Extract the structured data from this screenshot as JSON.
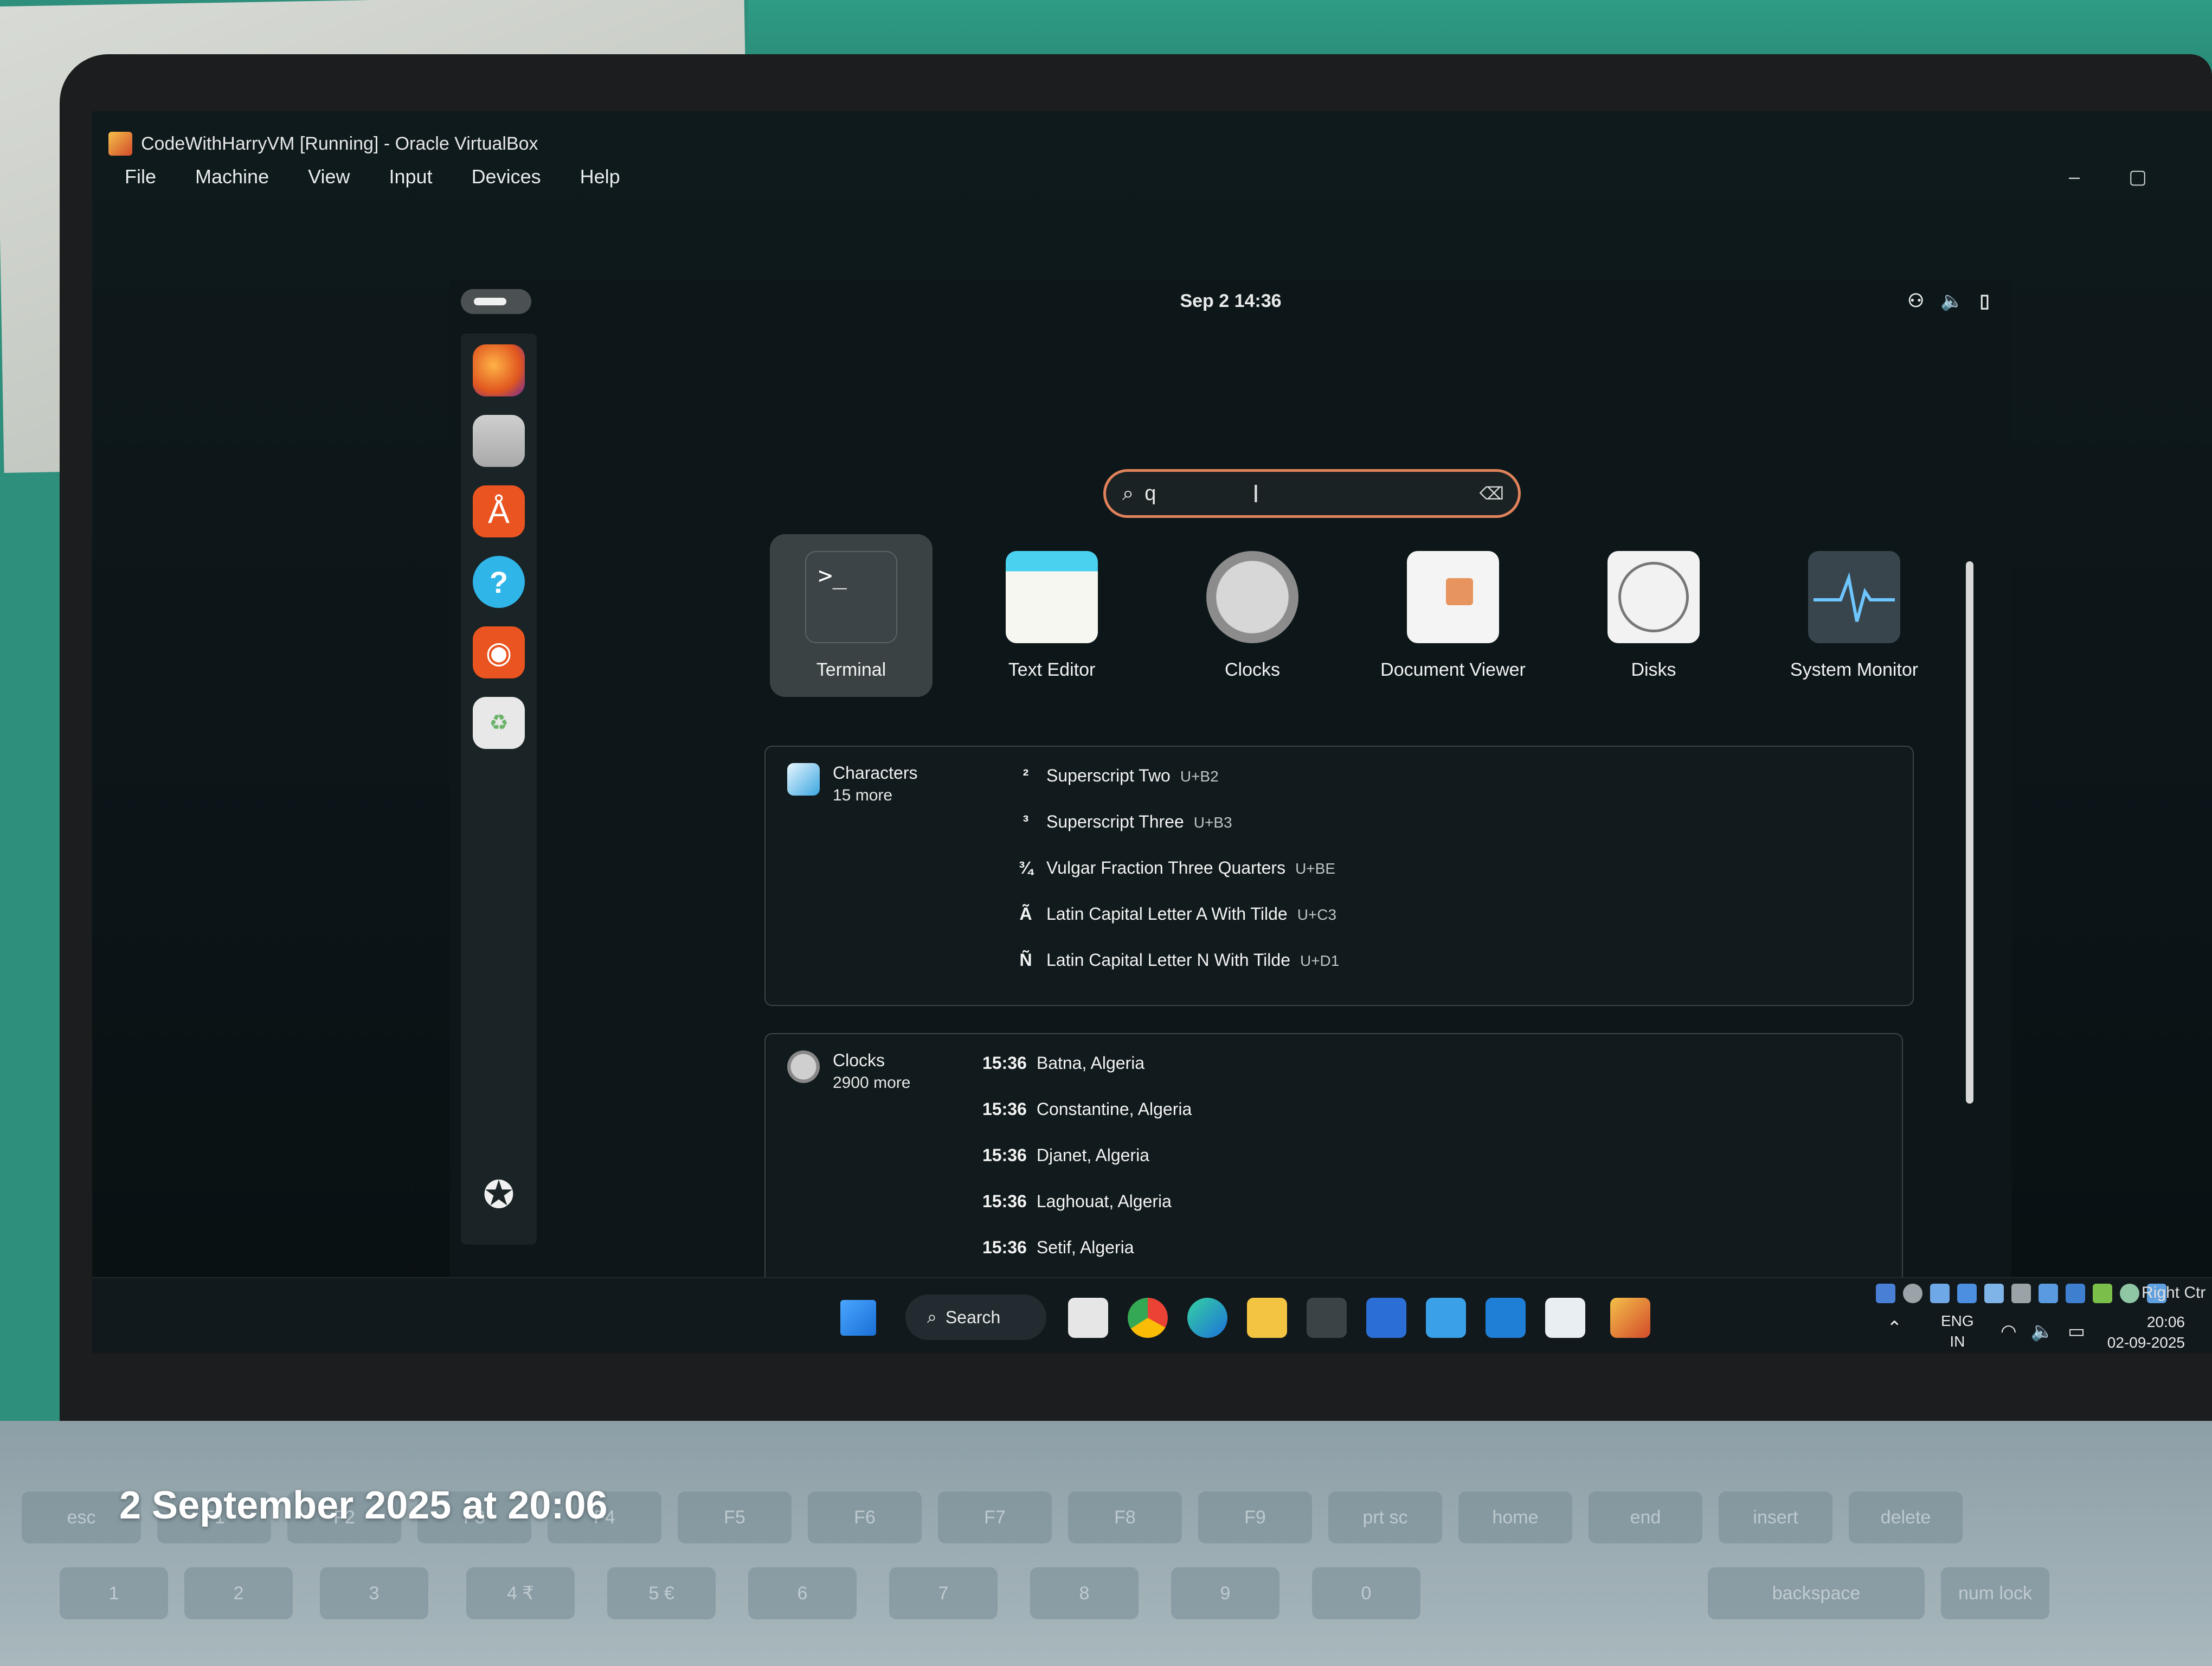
{
  "photo_caption": "2 September 2025 at 20:06",
  "virtualbox": {
    "title": "CodeWithHarryVM [Running] - Oracle VirtualBox",
    "menu": [
      "File",
      "Machine",
      "View",
      "Input",
      "Devices",
      "Help"
    ],
    "window_buttons": [
      "–",
      "▢"
    ]
  },
  "ubuntu": {
    "topbar": {
      "datetime": "Sep 2  14:36",
      "icons": [
        "network-icon",
        "volume-icon",
        "battery-icon"
      ]
    },
    "search": {
      "query": "q",
      "placeholder": ""
    },
    "apps": [
      {
        "label": "Terminal",
        "selected": true
      },
      {
        "label": "Text Editor",
        "selected": false
      },
      {
        "label": "Clocks",
        "selected": false
      },
      {
        "label": "Document Viewer",
        "selected": false
      },
      {
        "label": "Disks",
        "selected": false
      },
      {
        "label": "System Monitor",
        "selected": false
      }
    ],
    "characters": {
      "name": "Characters",
      "more": "15 more",
      "results": [
        {
          "glyph": "²",
          "name": "Superscript Two",
          "code": "U+B2"
        },
        {
          "glyph": "³",
          "name": "Superscript Three",
          "code": "U+B3"
        },
        {
          "glyph": "¾",
          "name": "Vulgar Fraction Three Quarters",
          "code": "U+BE"
        },
        {
          "glyph": "Ã",
          "name": "Latin Capital Letter A With Tilde",
          "code": "U+C3"
        },
        {
          "glyph": "Ñ",
          "name": "Latin Capital Letter N With Tilde",
          "code": "U+D1"
        }
      ]
    },
    "clocks": {
      "name": "Clocks",
      "more": "2900 more",
      "results": [
        {
          "time": "15:36",
          "place": "Batna, Algeria"
        },
        {
          "time": "15:36",
          "place": "Constantine, Algeria"
        },
        {
          "time": "15:36",
          "place": "Djanet, Algeria"
        },
        {
          "time": "15:36",
          "place": "Laghouat, Algeria"
        },
        {
          "time": "15:36",
          "place": "Setif, Algeria"
        }
      ]
    }
  },
  "windows_taskbar": {
    "search_label": "Search",
    "lang": {
      "line1": "ENG",
      "line2": "IN"
    },
    "clock": {
      "time": "20:06",
      "date": "02-09-2025"
    },
    "right_ctrl": "Right Ctr"
  },
  "keyboard": {
    "fn_row": [
      "esc",
      "F1",
      "F2",
      "F3",
      "F4",
      "F5",
      "F6",
      "F7",
      "F8",
      "F9",
      "prt sc",
      "home",
      "end",
      "insert",
      "delete"
    ],
    "num_row": [
      "1",
      "2",
      "3",
      "4 ₹",
      "5 €",
      "6",
      "7",
      "8",
      "9",
      "0",
      "backspace",
      "num lock"
    ]
  },
  "colors": {
    "search_border": "#e0825a",
    "screen_bg": "#0d1719",
    "accent_orange": "#e95420"
  }
}
